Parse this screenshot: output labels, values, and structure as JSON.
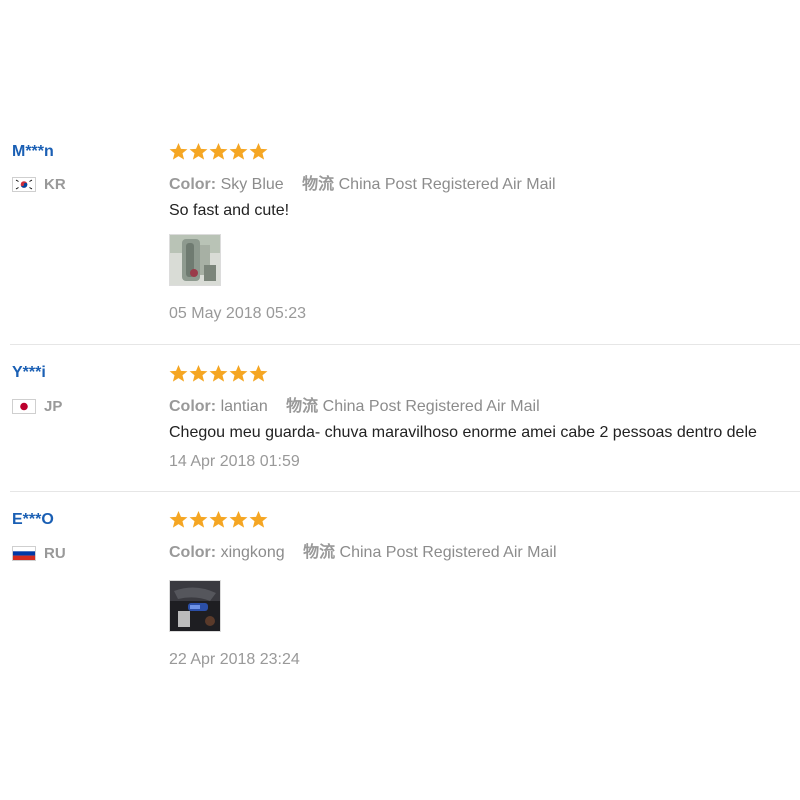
{
  "reviews": [
    {
      "user": "M***n",
      "country_code": "KR",
      "flag": "south-korea-flag",
      "rating": 5,
      "color_label": "Color:",
      "color_value": "Sky Blue",
      "shipping_label": "物流",
      "shipping_value": "China Post Registered Air Mail",
      "comment": "So fast and cute!",
      "photo": "umbrella-photo-icon",
      "date": "05 May 2018 05:23"
    },
    {
      "user": "Y***i",
      "country_code": "JP",
      "flag": "japan-flag",
      "rating": 5,
      "color_label": "Color:",
      "color_value": "lantian",
      "shipping_label": "物流",
      "shipping_value": "China Post Registered Air Mail",
      "comment": "Chegou meu guarda- chuva maravilhoso enorme amei cabe 2 pessoas dentro dele",
      "date": "14 Apr 2018 01:59"
    },
    {
      "user": "E***O",
      "country_code": "RU",
      "flag": "russia-flag",
      "rating": 5,
      "color_label": "Color:",
      "color_value": "xingkong",
      "shipping_label": "物流",
      "shipping_value": "China Post Registered Air Mail",
      "photo": "umbrella-photo-icon",
      "date": "22 Apr 2018 23:24"
    }
  ],
  "colors": {
    "star": "#f5a623",
    "username": "#1a5fb4"
  }
}
